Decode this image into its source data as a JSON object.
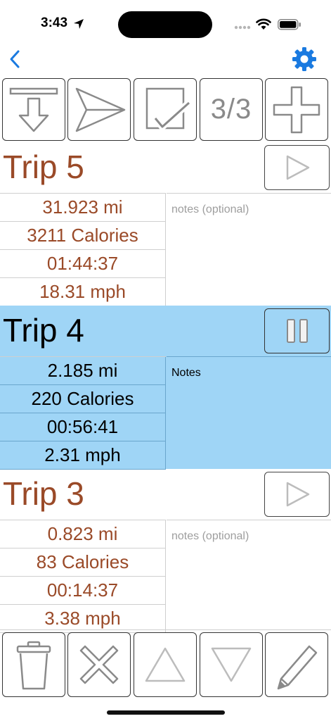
{
  "status": {
    "time": "3:43"
  },
  "toolbar": {
    "counter": "3/3"
  },
  "trips": [
    {
      "title": "Trip 5",
      "distance": "31.923 mi",
      "calories": "3211 Calories",
      "duration": "01:44:37",
      "speed": "18.31 mph",
      "notes_placeholder": "notes (optional)",
      "state": "stopped"
    },
    {
      "title": "Trip 4",
      "distance": "2.185 mi",
      "calories": "220 Calories",
      "duration": "00:56:41",
      "speed": "2.31 mph",
      "notes": "Notes",
      "state": "running"
    },
    {
      "title": "Trip 3",
      "distance": "0.823 mi",
      "calories": "83 Calories",
      "duration": "00:14:37",
      "speed": "3.38 mph",
      "notes_placeholder": "notes (optional)",
      "state": "stopped"
    }
  ],
  "colors": {
    "accent": "#1a7ae0",
    "trip_text": "#9a4a28",
    "active_row": "#9fd5f6",
    "icon_gray": "#8a8a8a"
  },
  "icons": {
    "toolbar": [
      "download-icon",
      "send-icon",
      "checkbox-icon",
      "plus-icon"
    ],
    "bottom": [
      "trash-icon",
      "close-icon",
      "triangle-up-icon",
      "triangle-down-icon",
      "pencil-icon"
    ]
  }
}
